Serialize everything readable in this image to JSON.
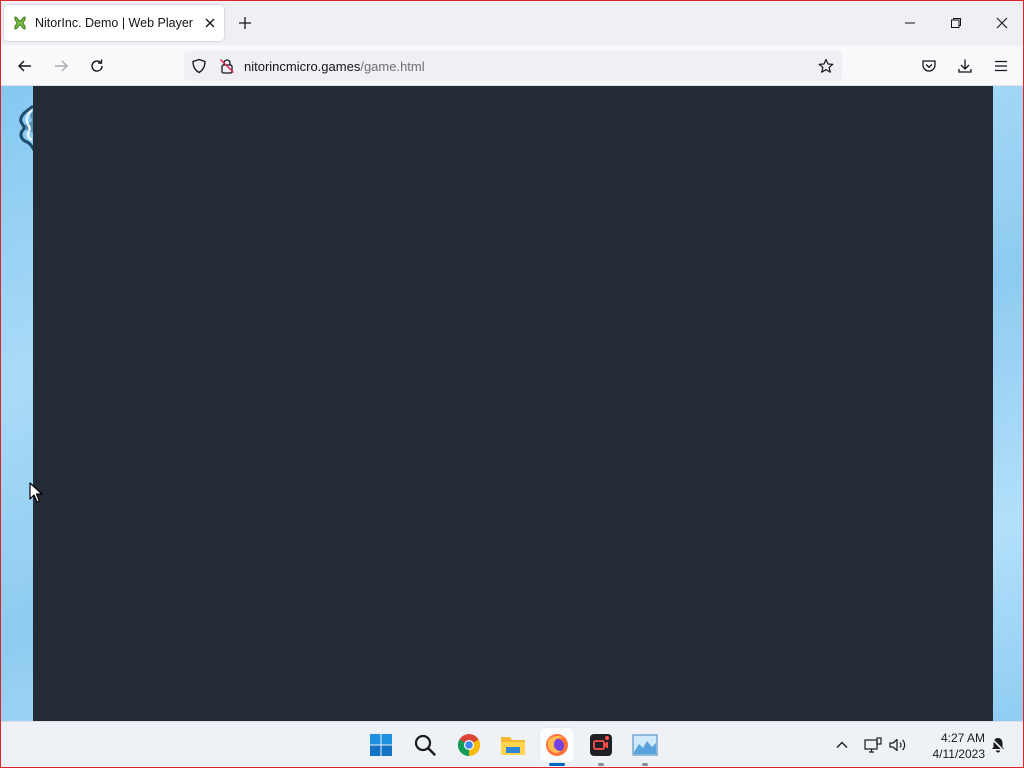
{
  "browser": {
    "tab": {
      "title": "NitorInc. Demo | Web Player"
    },
    "url": {
      "domain": "nitorincmicro.games",
      "path": "/game.html"
    }
  },
  "taskbar": {
    "apps": [
      "start-icon",
      "search-icon",
      "chrome-icon",
      "file-explorer-icon",
      "firefox-icon",
      "screen-recorder-icon",
      "photos-icon"
    ],
    "clock": {
      "time": "4:27 AM",
      "date": "4/11/2023"
    }
  },
  "colors": {
    "canvas": "#222b36",
    "page_background": "#8ecbf1",
    "accent": "#0067c0"
  }
}
